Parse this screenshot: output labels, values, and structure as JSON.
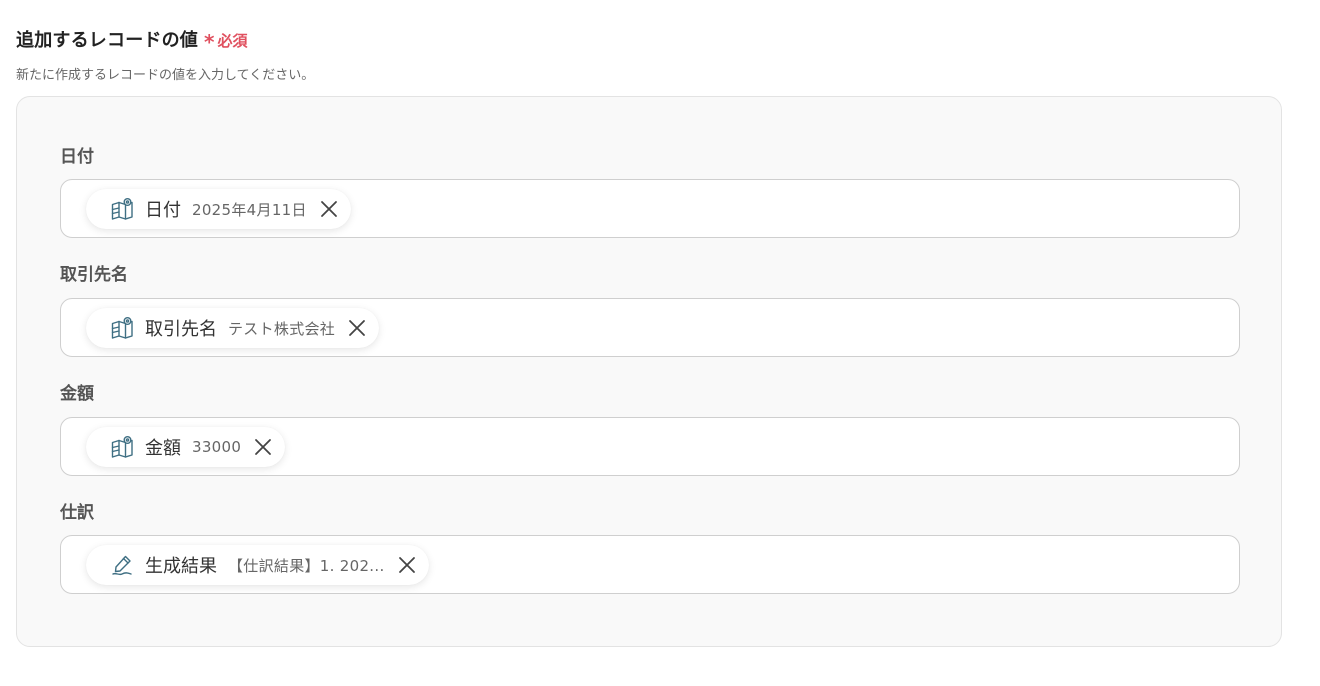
{
  "header": {
    "title": "追加するレコードの値",
    "required_mark": "*",
    "required_label": "必須",
    "description": "新たに作成するレコードの値を入力してください。"
  },
  "fields": [
    {
      "label": "日付",
      "chip": {
        "icon": "table-record-icon",
        "label": "日付",
        "value": "2025年4月11日"
      }
    },
    {
      "label": "取引先名",
      "chip": {
        "icon": "table-record-icon",
        "label": "取引先名",
        "value": "テスト株式会社"
      }
    },
    {
      "label": "金額",
      "chip": {
        "icon": "table-record-icon",
        "label": "金額",
        "value": "33000"
      }
    },
    {
      "label": "仕訳",
      "chip": {
        "icon": "ai-pen-icon",
        "label": "生成結果",
        "value": "【仕訳結果】1. 202..."
      }
    }
  ],
  "colors": {
    "required": "#e0505f",
    "icon_stroke": "#3f6f83",
    "panel_bg": "#f9f9f9"
  }
}
